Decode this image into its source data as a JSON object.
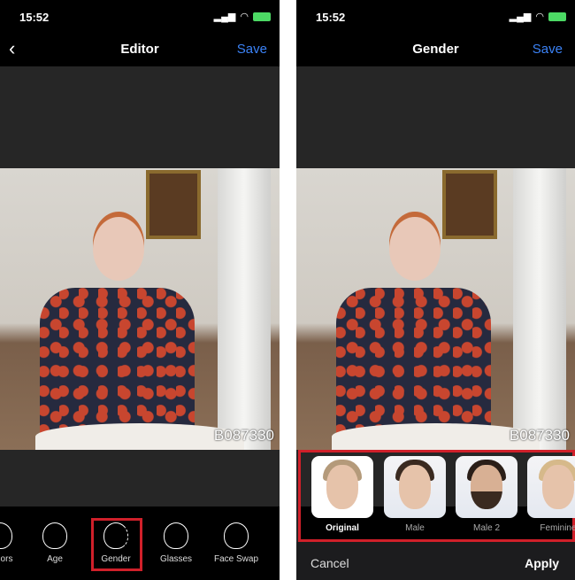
{
  "left": {
    "status": {
      "time": "15:52"
    },
    "nav": {
      "title": "Editor",
      "save": "Save"
    },
    "watermark": "B087330",
    "tools": [
      {
        "label": "Colors",
        "icon": "colors-face-icon"
      },
      {
        "label": "Age",
        "icon": "age-face-icon"
      },
      {
        "label": "Gender",
        "icon": "gender-face-icon",
        "selected": true
      },
      {
        "label": "Glasses",
        "icon": "glasses-face-icon"
      },
      {
        "label": "Face Swap",
        "icon": "face-swap-icon"
      }
    ]
  },
  "right": {
    "status": {
      "time": "15:52"
    },
    "nav": {
      "title": "Gender",
      "save": "Save"
    },
    "watermark": "B087330",
    "options": [
      {
        "label": "Original",
        "selected": true
      },
      {
        "label": "Male"
      },
      {
        "label": "Male 2"
      },
      {
        "label": "Feminine"
      }
    ],
    "cancel": "Cancel",
    "apply": "Apply"
  },
  "colors": {
    "accent": "#3b82f6",
    "highlight": "#d0202a"
  }
}
